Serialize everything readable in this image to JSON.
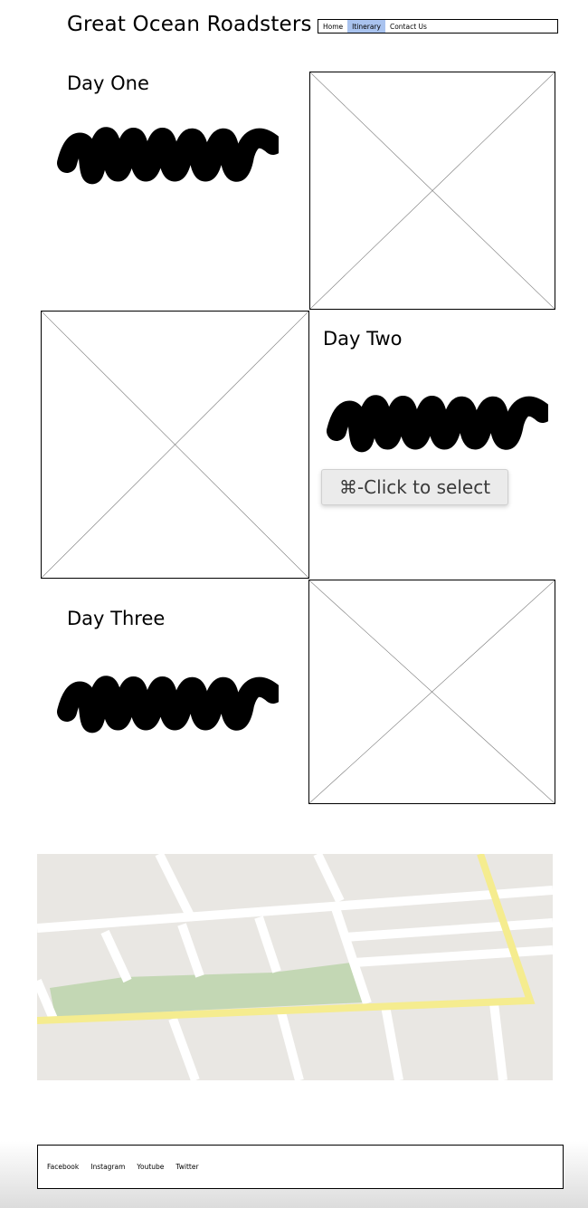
{
  "header": {
    "title": "Great Ocean Roadsters",
    "nav": [
      {
        "label": "Home",
        "active": false
      },
      {
        "label": "Itinerary",
        "active": true
      },
      {
        "label": "Contact Us",
        "active": false
      }
    ],
    "active_color": "#a9c3ef"
  },
  "days": [
    {
      "heading": "Day One"
    },
    {
      "heading": "Day Two"
    },
    {
      "heading": "Day Three"
    }
  ],
  "tooltip": {
    "text": "⌘-Click to select"
  },
  "map": {
    "colors": {
      "land": "#e9e7e3",
      "road": "#ffffff",
      "highway": "#f5ec8f",
      "park": "#c3d7b4"
    }
  },
  "footer": {
    "links": [
      "Facebook",
      "Instagram",
      "Youtube",
      "Twitter"
    ]
  }
}
